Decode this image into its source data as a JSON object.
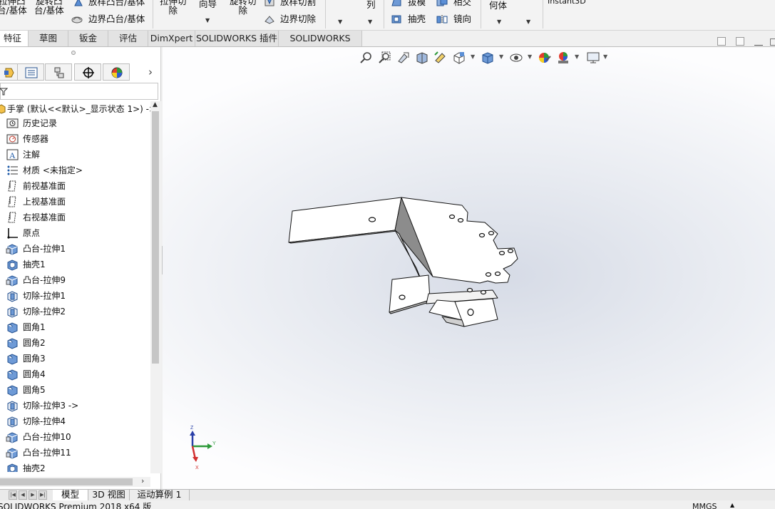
{
  "ribbon": {
    "extrude_boss_l1": "拉伸凸",
    "extrude_boss_l2": "台/基体",
    "revolve_boss_l1": "旋转凸",
    "revolve_boss_l2": "台/基体",
    "loft_boss": "放样凸台/基体",
    "boundary_boss": "边界凸台/基体",
    "extrude_cut_l1": "拉伸切",
    "extrude_cut_l2": "除",
    "hole_wizard": "向导",
    "revolve_cut_l1": "旋转切",
    "revolve_cut_l2": "除",
    "loft_cut": "放样切割",
    "boundary_cut": "边界切除",
    "pattern": "列",
    "draft": "拔模",
    "shell": "抽壳",
    "intersect": "相交",
    "mirror": "镜向",
    "ref_geometry": "何体",
    "instant3d": "Instant3D"
  },
  "tabs": [
    {
      "label": "特征",
      "active": true
    },
    {
      "label": "草图",
      "active": false
    },
    {
      "label": "钣金",
      "active": false
    },
    {
      "label": "评估",
      "active": false
    },
    {
      "label": "DimXpert",
      "active": false
    },
    {
      "label": "SOLIDWORKS 插件",
      "active": false
    },
    {
      "label": "SOLIDWORKS MBD",
      "active": false
    }
  ],
  "tree": {
    "root": "手掌 (默认<<默认>_显示状态 1>) ->",
    "items": [
      {
        "label": "历史记录",
        "icon": "history-icon"
      },
      {
        "label": "传感器",
        "icon": "sensor-icon"
      },
      {
        "label": "注解",
        "icon": "annotation-icon"
      },
      {
        "label": "材质 <未指定>",
        "icon": "material-icon"
      },
      {
        "label": "前视基准面",
        "icon": "plane-icon"
      },
      {
        "label": "上视基准面",
        "icon": "plane-icon"
      },
      {
        "label": "右视基准面",
        "icon": "plane-icon"
      },
      {
        "label": "原点",
        "icon": "origin-icon"
      },
      {
        "label": "凸台-拉伸1",
        "icon": "boss-extrude-icon"
      },
      {
        "label": "抽壳1",
        "icon": "shell-icon"
      },
      {
        "label": "凸台-拉伸9",
        "icon": "boss-extrude-icon"
      },
      {
        "label": "切除-拉伸1",
        "icon": "cut-extrude-icon"
      },
      {
        "label": "切除-拉伸2",
        "icon": "cut-extrude-icon"
      },
      {
        "label": "圆角1",
        "icon": "fillet-icon"
      },
      {
        "label": "圆角2",
        "icon": "fillet-icon"
      },
      {
        "label": "圆角3",
        "icon": "fillet-icon"
      },
      {
        "label": "圆角4",
        "icon": "fillet-icon"
      },
      {
        "label": "圆角5",
        "icon": "fillet-icon"
      },
      {
        "label": "切除-拉伸3 ->",
        "icon": "cut-extrude-icon"
      },
      {
        "label": "切除-拉伸4",
        "icon": "cut-extrude-icon"
      },
      {
        "label": "凸台-拉伸10",
        "icon": "boss-extrude-icon"
      },
      {
        "label": "凸台-拉伸11",
        "icon": "boss-extrude-icon"
      },
      {
        "label": "抽壳2",
        "icon": "shell-icon"
      }
    ]
  },
  "bottom_tabs": [
    {
      "label": "模型",
      "active": true
    },
    {
      "label": "3D 视图",
      "active": false
    },
    {
      "label": "运动算例 1",
      "active": false
    }
  ],
  "status": {
    "text": "SOLIDWORKS Premium 2018 x64 版",
    "units": "MMGS"
  },
  "triad": {
    "x": "X",
    "y": "Y",
    "z": "Z"
  },
  "colors": {
    "accent": "#1e5aa8",
    "viewport_center": "#d6dbe6",
    "panel_bg": "#ffffff"
  }
}
